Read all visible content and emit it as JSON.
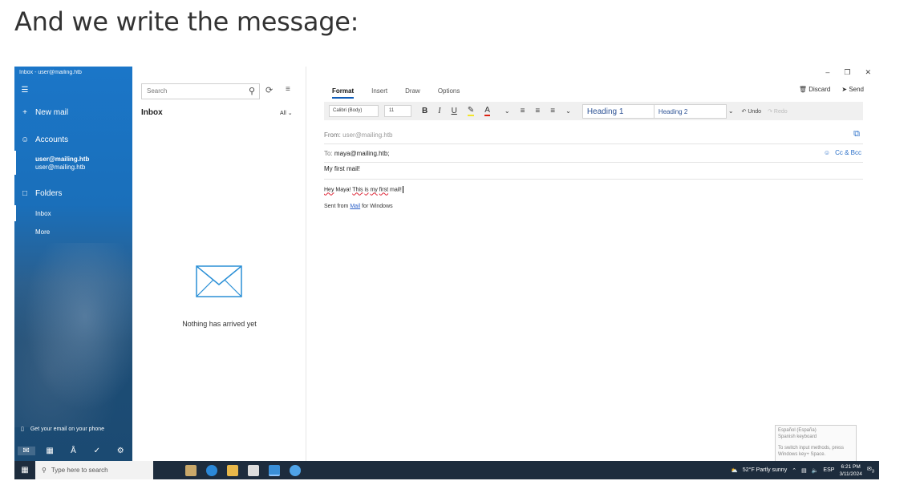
{
  "page_heading": "And we write the message:",
  "window_title": "Inbox - user@mailing.htb",
  "sidebar": {
    "new_mail": "New mail",
    "accounts": "Accounts",
    "account_name": "user@mailing.htb",
    "account_email": "user@mailing.htb",
    "folders": "Folders",
    "inbox": "Inbox",
    "more": "More",
    "phone_promo": "Get your email on your phone"
  },
  "message_list": {
    "search_placeholder": "Search",
    "title": "Inbox",
    "filter": "All",
    "empty_text": "Nothing has arrived yet"
  },
  "compose": {
    "tabs": [
      "Format",
      "Insert",
      "Draw",
      "Options"
    ],
    "discard": "Discard",
    "send": "Send",
    "font_name": "Calibri (Body)",
    "font_size": "11",
    "heading1": "Heading 1",
    "heading2": "Heading 2",
    "undo": "Undo",
    "redo": "Redo",
    "from_label": "From:",
    "from_value": "user@mailing.htb",
    "to_label": "To:",
    "to_value": "maya@mailing.htb;",
    "cc_bcc": "Cc & Bcc",
    "subject": "My first mail!",
    "body_w1": "Hey",
    "body_w2": "Maya!",
    "body_w3": "This",
    "body_w4": "is",
    "body_w5": "my",
    "body_w6": "first",
    "body_w7": "mail!",
    "sig_prefix": "Sent from",
    "sig_link": "Mail",
    "sig_suffix": "for Windows"
  },
  "ime_tooltip": {
    "line1": "Español (España)",
    "line2": "Spanish keyboard",
    "line3": "To switch input methods, press",
    "line4": "Windows key+ Space."
  },
  "taskbar": {
    "search_placeholder": "Type here to search",
    "weather": "52°F  Partly sunny",
    "lang": "ESP",
    "time": "6:21 PM",
    "date": "3/11/2024",
    "notif_count": "3"
  }
}
